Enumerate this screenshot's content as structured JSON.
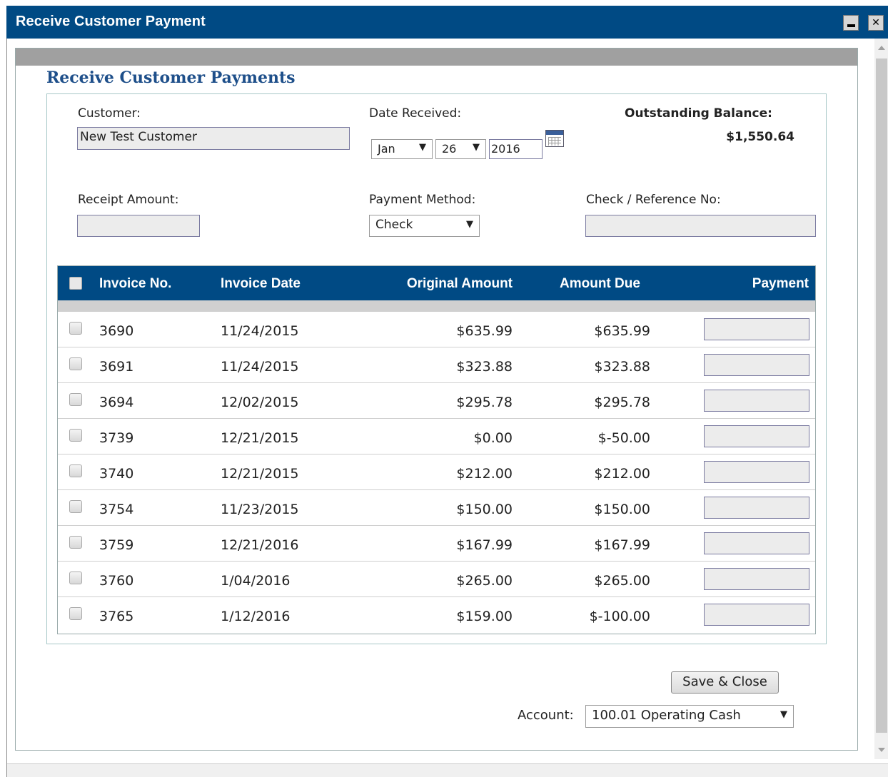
{
  "window": {
    "title": "Receive Customer Payment",
    "minimize_glyph": "_",
    "close_glyph": "✕"
  },
  "page": {
    "heading": "Receive Customer Payments"
  },
  "form": {
    "customer_label": "Customer:",
    "customer_value": "New Test Customer",
    "date_label": "Date Received:",
    "date_month": "Jan",
    "date_day": "26",
    "date_year": "2016",
    "balance_label": "Outstanding Balance:",
    "balance_value": "$1,550.64",
    "receipt_label": "Receipt Amount:",
    "receipt_value": "",
    "method_label": "Payment Method:",
    "method_value": "Check",
    "reference_label": "Check / Reference No:",
    "reference_value": ""
  },
  "table": {
    "headers": {
      "invoice_no": "Invoice No.",
      "invoice_date": "Invoice Date",
      "original_amount": "Original Amount",
      "amount_due": "Amount Due",
      "payment": "Payment"
    },
    "rows": [
      {
        "invoice_no": "3690",
        "invoice_date": "11/24/2015",
        "original_amount": "$635.99",
        "amount_due": "$635.99",
        "payment": ""
      },
      {
        "invoice_no": "3691",
        "invoice_date": "11/24/2015",
        "original_amount": "$323.88",
        "amount_due": "$323.88",
        "payment": ""
      },
      {
        "invoice_no": "3694",
        "invoice_date": "12/02/2015",
        "original_amount": "$295.78",
        "amount_due": "$295.78",
        "payment": ""
      },
      {
        "invoice_no": "3739",
        "invoice_date": "12/21/2015",
        "original_amount": "$0.00",
        "amount_due": "$-50.00",
        "payment": ""
      },
      {
        "invoice_no": "3740",
        "invoice_date": "12/21/2015",
        "original_amount": "$212.00",
        "amount_due": "$212.00",
        "payment": ""
      },
      {
        "invoice_no": "3754",
        "invoice_date": "11/23/2015",
        "original_amount": "$150.00",
        "amount_due": "$150.00",
        "payment": ""
      },
      {
        "invoice_no": "3759",
        "invoice_date": "12/21/2016",
        "original_amount": "$167.99",
        "amount_due": "$167.99",
        "payment": ""
      },
      {
        "invoice_no": "3760",
        "invoice_date": "1/04/2016",
        "original_amount": "$265.00",
        "amount_due": "$265.00",
        "payment": ""
      },
      {
        "invoice_no": "3765",
        "invoice_date": "1/12/2016",
        "original_amount": "$159.00",
        "amount_due": "$-100.00",
        "payment": ""
      }
    ]
  },
  "footer": {
    "save_label": "Save & Close",
    "account_label": "Account:",
    "account_value": "100.01 Operating Cash"
  },
  "colors": {
    "title_bar": "#004a84",
    "heading": "#1e4f8a"
  },
  "icons": {
    "date_picker": "calendar-icon",
    "dropdown": "chevron-down-icon"
  }
}
